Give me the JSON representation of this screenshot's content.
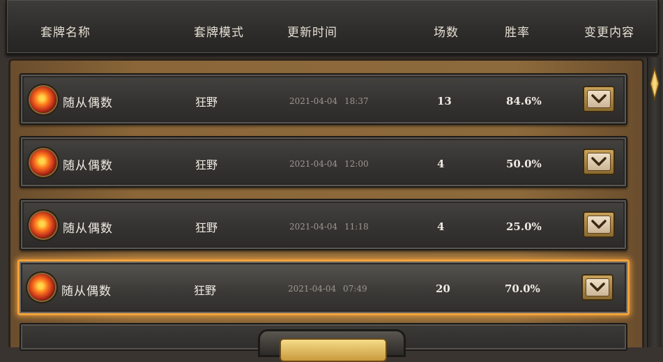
{
  "header": {
    "col_deck_name": "套牌名称",
    "col_mode": "套牌模式",
    "col_update_time": "更新时间",
    "col_games": "场数",
    "col_win_rate": "胜率",
    "col_changes": "变更内容"
  },
  "rows": [
    {
      "deck_name": "随从偶数",
      "mode": "狂野",
      "updated": "2021-04-04 18:37",
      "games": "13",
      "win_rate": "84.6%",
      "selected": false
    },
    {
      "deck_name": "随从偶数",
      "mode": "狂野",
      "updated": "2021-04-04 12:00",
      "games": "4",
      "win_rate": "50.0%",
      "selected": false
    },
    {
      "deck_name": "随从偶数",
      "mode": "狂野",
      "updated": "2021-04-04 11:18",
      "games": "4",
      "win_rate": "25.0%",
      "selected": false
    },
    {
      "deck_name": "随从偶数",
      "mode": "狂野",
      "updated": "2021-04-04 07:49",
      "games": "20",
      "win_rate": "70.0%",
      "selected": true
    }
  ],
  "icons": {
    "deck": "deck-class-badge-icon",
    "expand": "chevron-down-icon",
    "scroll": "scroll-thumb-icon"
  },
  "colors": {
    "selected_glow": "#f2a23a",
    "text": "#eeeae2",
    "muted_time": "#9c9891",
    "tray_wood": "#8a6638"
  }
}
